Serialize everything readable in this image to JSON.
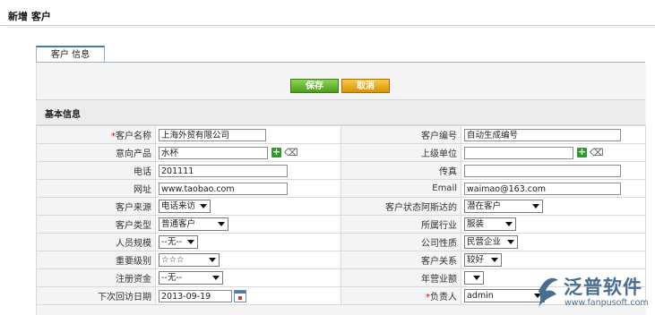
{
  "page": {
    "title": "新增 客户"
  },
  "tabs": [
    {
      "label": "客户 信息"
    }
  ],
  "toolbar": {
    "save_label": "保存",
    "cancel_label": "取消"
  },
  "section": {
    "title": "基本信息"
  },
  "form": {
    "customer_name": {
      "label": "客户名称",
      "required_mark": "*",
      "value": "上海外贸有限公司"
    },
    "customer_no": {
      "label": "客户编号",
      "value": "自动生成编号"
    },
    "intended_product": {
      "label": "意向产品",
      "value": "水杯"
    },
    "parent_unit": {
      "label": "上级单位",
      "value": ""
    },
    "phone": {
      "label": "电话",
      "value": "201111"
    },
    "fax": {
      "label": "传真",
      "value": ""
    },
    "website": {
      "label": "网址",
      "value": "www.taobao.com"
    },
    "email": {
      "label": "Email",
      "value": "waimao@163.com"
    },
    "source": {
      "label": "客户来源",
      "value": "电话来访"
    },
    "status": {
      "label": "客户状态阿斯达的",
      "value": "潜在客户"
    },
    "type": {
      "label": "客户类型",
      "value": "普通客户"
    },
    "industry": {
      "label": "所属行业",
      "value": "服装"
    },
    "staff_size": {
      "label": "人员规模",
      "value": "--无--"
    },
    "company_nature": {
      "label": "公司性质",
      "value": "民营企业"
    },
    "importance": {
      "label": "重要级别",
      "value": "☆☆☆"
    },
    "relation": {
      "label": "客户关系",
      "value": "较好"
    },
    "capital": {
      "label": "注册资金",
      "value": "--无--"
    },
    "revenue": {
      "label": "年营业额",
      "value": ""
    },
    "next_visit": {
      "label": "下次回访日期",
      "value": "2013-09-19"
    },
    "owner": {
      "label": "负责人",
      "required_mark": "*",
      "value": "admin"
    }
  },
  "logo": {
    "text": "泛普软件",
    "url": "www.fanpusoft.com"
  },
  "colors": {
    "save": "#5aa82a",
    "cancel": "#e8a50f",
    "tab_border": "#3f7bb5"
  }
}
